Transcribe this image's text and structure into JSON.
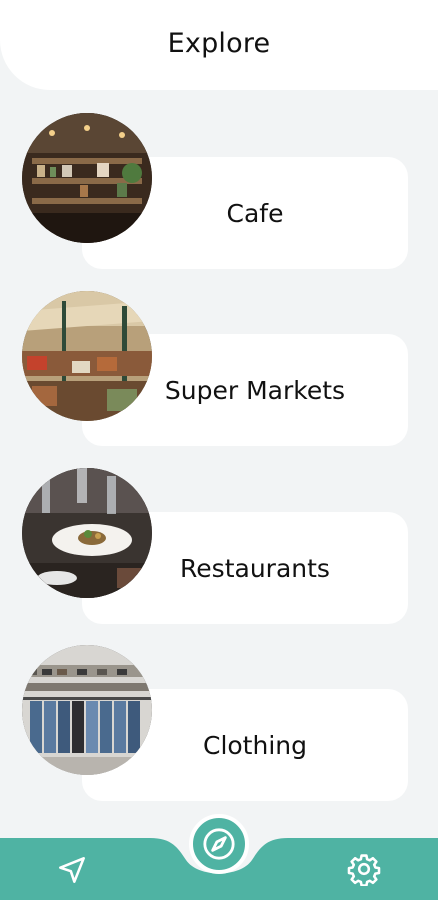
{
  "header": {
    "title": "Explore"
  },
  "categories": [
    {
      "label": "Cafe",
      "icon": "cafe-photo"
    },
    {
      "label": "Super Markets",
      "icon": "supermarket-photo"
    },
    {
      "label": "Restaurants",
      "icon": "restaurant-photo"
    },
    {
      "label": "Clothing",
      "icon": "clothing-photo"
    }
  ],
  "bottom_nav": {
    "left_icon": "navigation-arrow-icon",
    "center_icon": "compass-icon",
    "right_icon": "gear-icon"
  },
  "colors": {
    "accent": "#4fb3a3",
    "background": "#f2f4f5",
    "card": "#ffffff"
  }
}
